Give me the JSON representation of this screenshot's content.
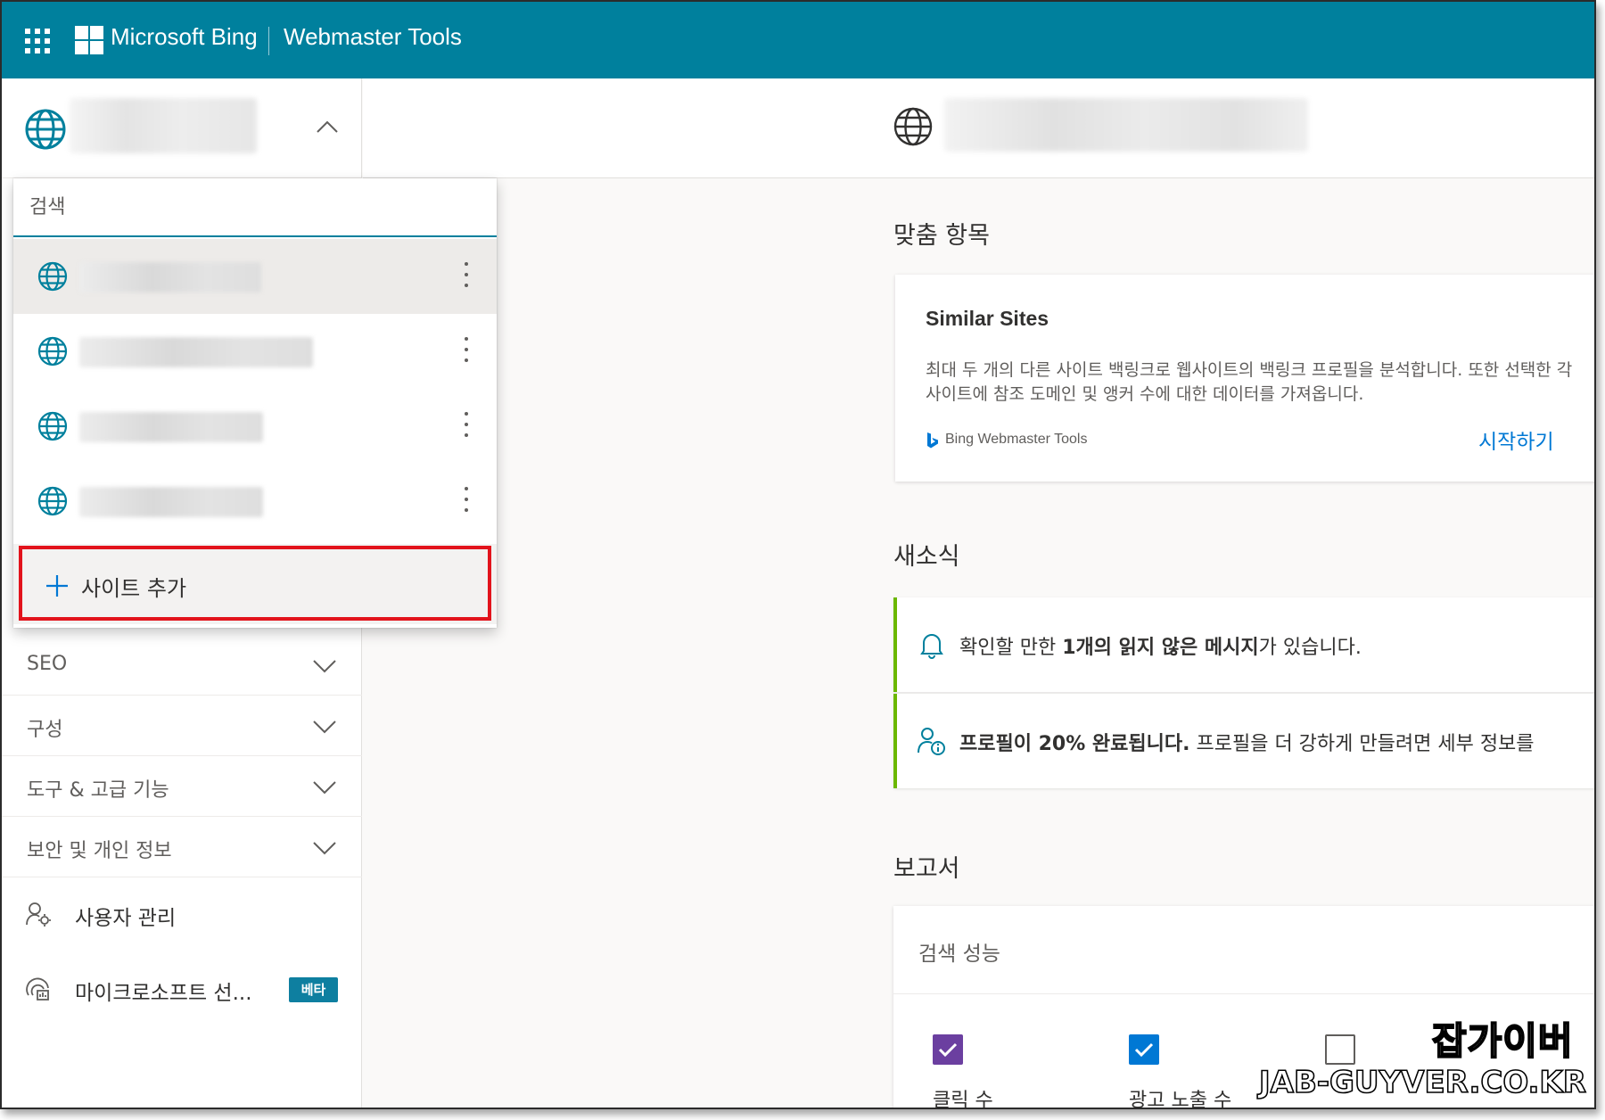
{
  "header": {
    "brand": "Microsoft Bing",
    "product": "Webmaster Tools"
  },
  "site_dropdown": {
    "search_placeholder": "검색",
    "add_site_label": "사이트 추가"
  },
  "sidebar": {
    "nav": [
      {
        "label": "SEO"
      },
      {
        "label": "구성"
      },
      {
        "label": "도구 & 고급 기능"
      },
      {
        "label": "보안 및 개인 정보"
      }
    ],
    "user_management": "사용자 관리",
    "microsoft_clarity": "마이크로소프트 선...",
    "beta_badge": "베타"
  },
  "main": {
    "recommended_title": "맞춤 항목",
    "similar_sites": {
      "title": "Similar Sites",
      "description": "최대 두 개의 다른 사이트 백링크로 웹사이트의 백링크 프로필을 분석합니다. 또한 선택한 각 사이트에 참조 도메인 및 앵커 수에 대한 데이터를 가져옵니다.",
      "source": "Bing Webmaster Tools",
      "action": "시작하기"
    },
    "news_title": "새소식",
    "news": {
      "message_pre": "확인할 만한 ",
      "message_bold": "1개의 읽지 않은 메시지",
      "message_post": "가 있습니다.",
      "profile_bold": "프로필이 20% 완료됩니다.",
      "profile_post": " 프로필을 더 강하게 만들려면 세부 정보를"
    },
    "reports_title": "보고서",
    "search_performance": {
      "title": "검색 성능",
      "metrics": [
        {
          "label": "클릭 수",
          "checked": true,
          "color": "#6b3fa0"
        },
        {
          "label": "광고 노출 수",
          "checked": true,
          "color": "#0078d4"
        },
        {
          "label": "",
          "checked": false,
          "color": "#605e5c"
        }
      ]
    }
  },
  "watermark": {
    "line1": "잡가이버",
    "line2": "JAB-GUYVER.CO.KR"
  },
  "colors": {
    "topbar": "#00809d",
    "highlight_border": "#e2131c",
    "news_accent": "#6bb700",
    "link": "#0078d4"
  }
}
